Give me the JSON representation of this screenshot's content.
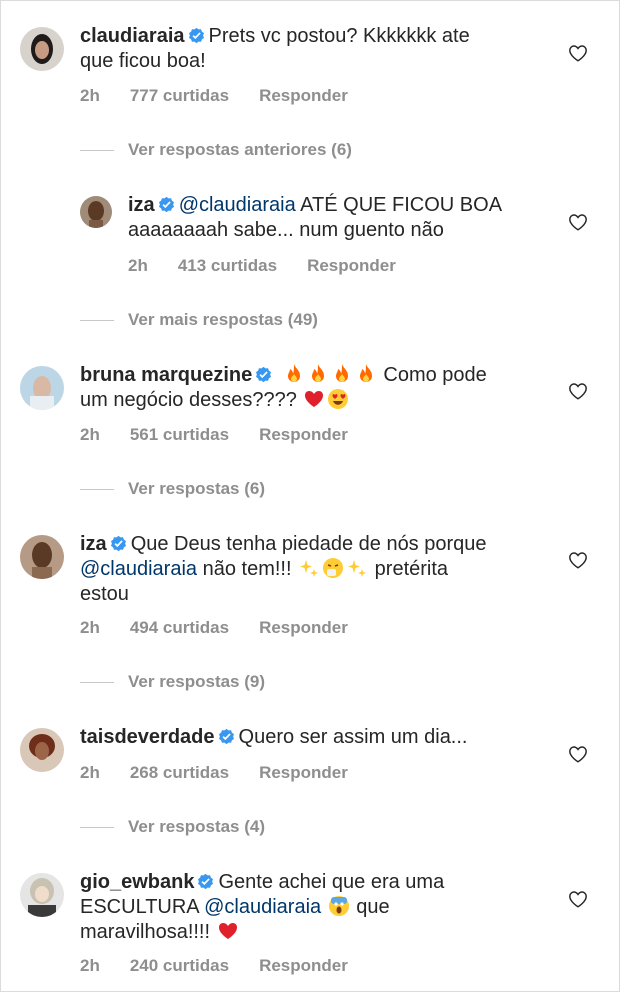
{
  "comments": [
    {
      "username": "claudiaraia",
      "text": [
        "Prets vc postou? Kkkkkkk ate",
        "que ficou boa!"
      ],
      "time": "2h",
      "likes": "777 curtidas",
      "reply": "Responder"
    },
    {
      "username": "iza",
      "mention": "@claudiaraia",
      "text": [
        "ATÉ QUE FICOU BOA",
        "aaaaaaaah sabe... num guento não"
      ],
      "time": "2h",
      "likes": "413 curtidas",
      "reply": "Responder"
    },
    {
      "username": "bruna marquezine",
      "text": [
        "Como pode",
        "um negócio desses????"
      ],
      "time": "2h",
      "likes": "561 curtidas",
      "reply": "Responder"
    },
    {
      "username": "iza",
      "text": [
        "Que Deus tenha piedade de nós porque",
        "não tem!!!",
        "pretérita",
        "estou"
      ],
      "mention": "@claudiaraia",
      "time": "2h",
      "likes": "494 curtidas",
      "reply": "Responder"
    },
    {
      "username": "taisdeverdade",
      "text": [
        "Quero ser assim um dia..."
      ],
      "time": "2h",
      "likes": "268 curtidas",
      "reply": "Responder"
    },
    {
      "username": "gio_ewbank",
      "mention": "@claudiaraia",
      "text": [
        "Gente achei que era uma",
        "ESCULTURA",
        "que",
        "maravilhosa!!!!"
      ],
      "time": "2h",
      "likes": "240 curtidas",
      "reply": "Responder"
    }
  ],
  "threads": {
    "previous": "Ver respostas anteriores (6)",
    "more": "Ver mais respostas (49)",
    "bruna": "Ver respostas (6)",
    "iza": "Ver respostas (9)",
    "tais": "Ver respostas (4)"
  },
  "icons": {
    "verified": "verified-badge-icon",
    "like": "heart-outline-icon"
  },
  "colors": {
    "text": "#262626",
    "secondary": "#8e8e8e",
    "verified": "#3897f0",
    "mention": "#00376b",
    "heart": "#ed4956"
  }
}
